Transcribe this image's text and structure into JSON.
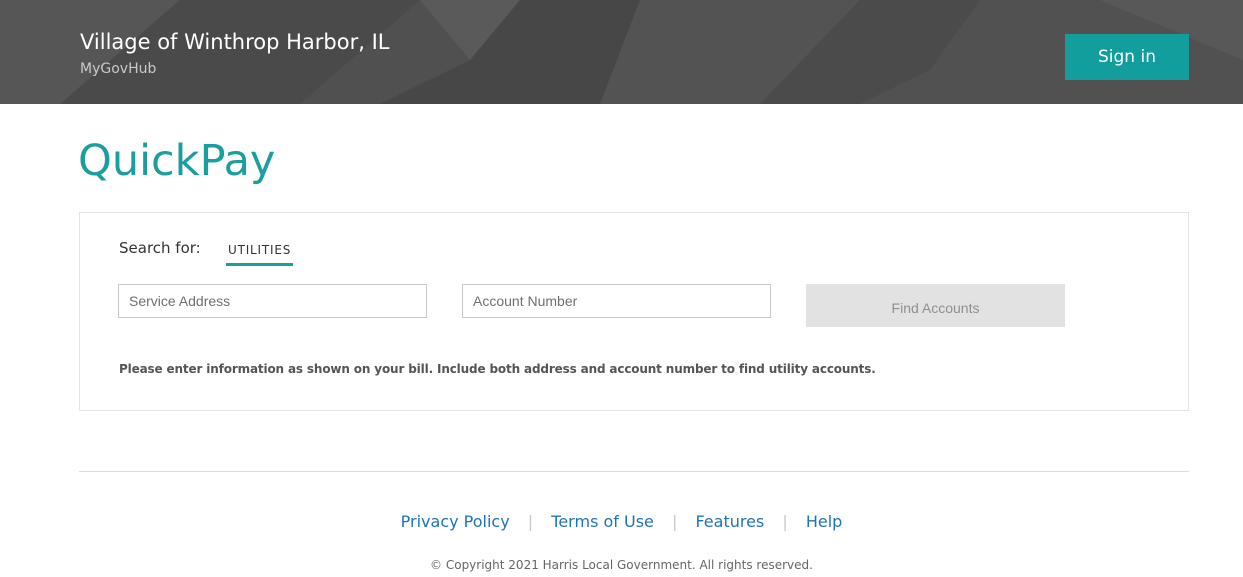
{
  "header": {
    "title": "Village of Winthrop Harbor, IL",
    "subtitle": "MyGovHub",
    "sign_in_label": "Sign in"
  },
  "page": {
    "title": "QuickPay"
  },
  "search": {
    "search_for_label": "Search for:",
    "tabs": [
      {
        "label": "UTILITIES",
        "active": true
      }
    ],
    "service_address": {
      "placeholder": "Service Address",
      "value": ""
    },
    "account_number": {
      "placeholder": "Account Number",
      "value": ""
    },
    "find_button_label": "Find Accounts",
    "help_text": "Please enter information as shown on your bill. Include both address and account number to find utility accounts."
  },
  "footer": {
    "links": [
      {
        "label": "Privacy Policy"
      },
      {
        "label": "Terms of Use"
      },
      {
        "label": "Features"
      },
      {
        "label": "Help"
      }
    ],
    "separator": "|",
    "copyright": "© Copyright 2021 Harris Local Government. All rights reserved."
  },
  "colors": {
    "accent": "#139e9e",
    "header_bg": "#4f4f4f",
    "link": "#1f73b7",
    "disabled_button_bg": "#e2e2e2"
  }
}
